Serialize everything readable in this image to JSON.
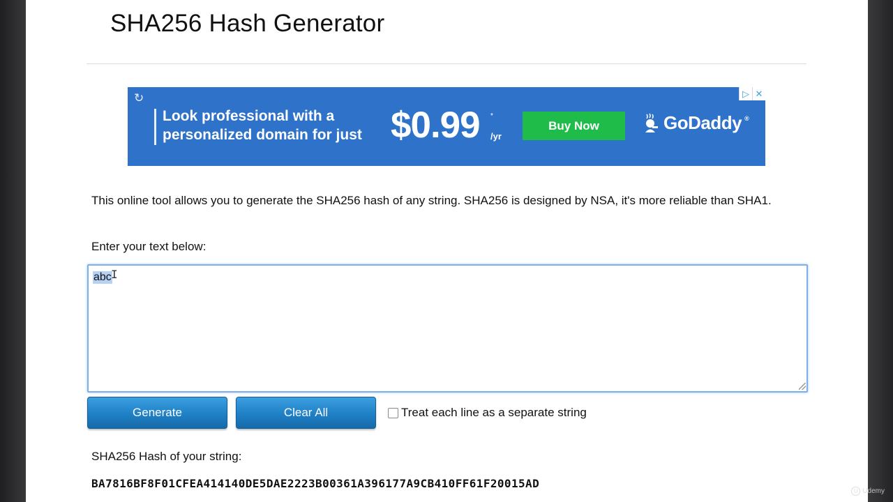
{
  "page": {
    "title": "SHA256 Hash Generator"
  },
  "ad": {
    "refresh_icon": "↻",
    "text_line1": "Look professional with a",
    "text_line2": "personalized domain for just",
    "price": "$0.99",
    "price_sup": "*",
    "price_unit": "/yr",
    "button_label": "Buy Now",
    "brand": "GoDaddy",
    "brand_tm": "®",
    "colors": {
      "background": "#2e72c9",
      "button": "#1fbc4a"
    }
  },
  "content": {
    "description": "This online tool allows you to generate the SHA256 hash of any string. SHA256 is designed by NSA, it's more reliable than SHA1.",
    "input_label": "Enter your text below:",
    "input_value": "abc",
    "generate_label": "Generate",
    "clear_label": "Clear All",
    "checkbox_label": "Treat each line as a separate string",
    "checkbox_checked": false,
    "result_label": "SHA256 Hash of your string:",
    "result_hash": "BA7816BF8F01CFEA414140DE5DAE2223B00361A396177A9CB410FF61F20015AD"
  },
  "watermark": {
    "text": "Udemy"
  }
}
